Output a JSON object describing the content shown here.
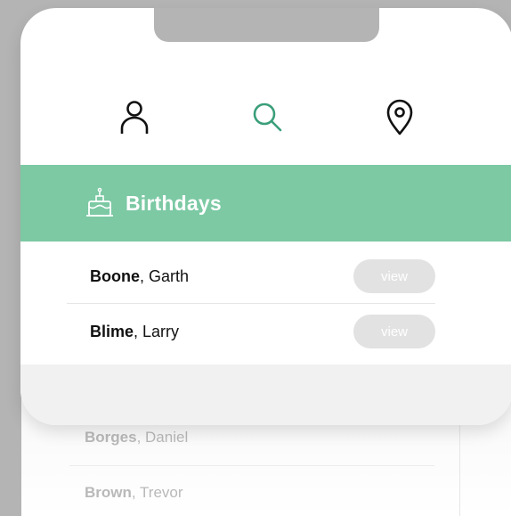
{
  "nav": {
    "items": [
      {
        "icon": "person-icon"
      },
      {
        "icon": "search-icon",
        "color": "#3a9e7a"
      },
      {
        "icon": "location-pin-icon"
      }
    ]
  },
  "banner": {
    "icon": "birthday-cake-icon",
    "title": "Birthdays",
    "color": "#7cc9a4"
  },
  "birthdays": [
    {
      "last": "Boone",
      "first": ", Garth",
      "action": "view"
    },
    {
      "last": "Blime",
      "first": ", Larry",
      "action": "view"
    }
  ],
  "background_list": [
    {
      "last": "Borges",
      "first": ", Daniel"
    },
    {
      "last": "Brown",
      "first": ", Trevor"
    }
  ]
}
